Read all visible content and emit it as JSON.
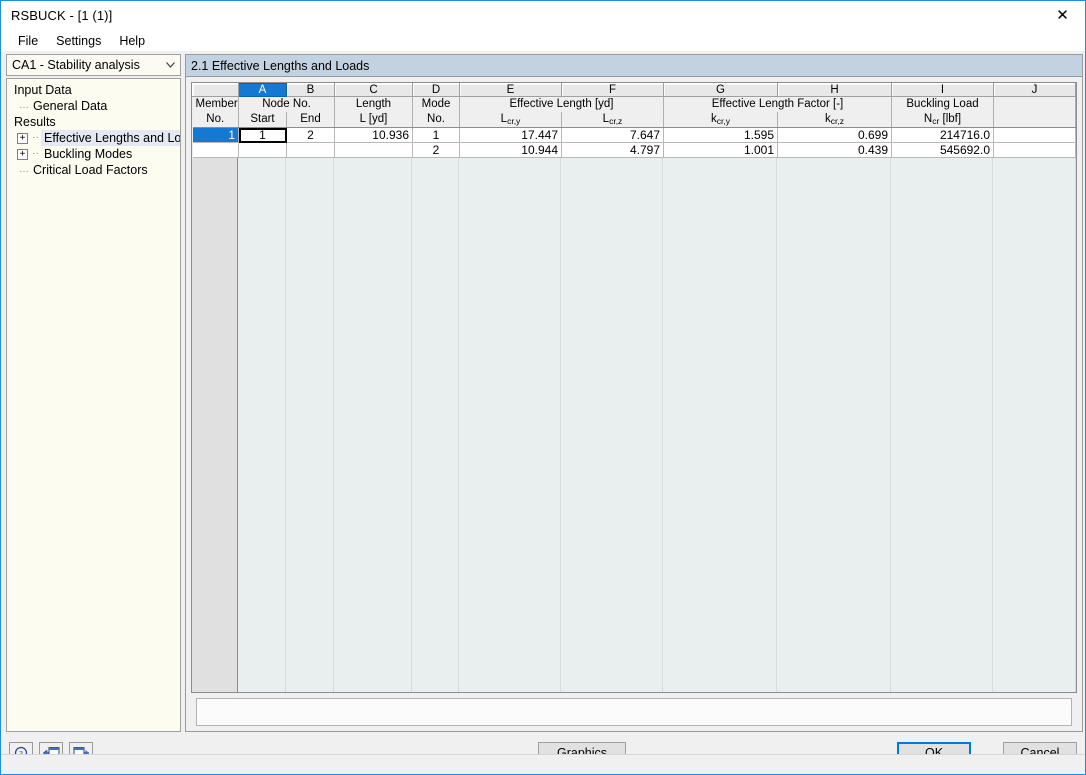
{
  "window": {
    "title": "RSBUCK - [1 (1)]",
    "close_icon": "close-icon"
  },
  "menubar": {
    "items": [
      {
        "label": "File"
      },
      {
        "label": "Settings"
      },
      {
        "label": "Help"
      }
    ]
  },
  "sidebar": {
    "combo": {
      "value": "CA1 - Stability analysis",
      "arrow_icon": "chevron-down-icon"
    },
    "tree": [
      {
        "label": "Input Data",
        "level": 0,
        "expander": "",
        "selected": false
      },
      {
        "label": "General Data",
        "level": 1,
        "expander": "",
        "selected": false
      },
      {
        "label": "Results",
        "level": 0,
        "expander": "",
        "selected": false
      },
      {
        "label": "Effective Lengths and Loads",
        "level": 1,
        "expander": "+",
        "selected": true
      },
      {
        "label": "Buckling Modes",
        "level": 1,
        "expander": "+",
        "selected": false
      },
      {
        "label": "Critical Load Factors",
        "level": 1,
        "expander": "",
        "selected": false
      }
    ]
  },
  "panel": {
    "title": "2.1 Effective Lengths and Loads"
  },
  "table": {
    "column_letters": [
      "",
      "A",
      "B",
      "C",
      "D",
      "E",
      "F",
      "G",
      "H",
      "I",
      "J"
    ],
    "selected_letter": "A",
    "group_headers": [
      {
        "text": "Member",
        "span": 1
      },
      {
        "text": "Node No.",
        "span": 2
      },
      {
        "text": "Length",
        "span": 1
      },
      {
        "text": "Mode",
        "span": 1
      },
      {
        "text": "Effective Length [yd]",
        "span": 2
      },
      {
        "text": "Effective Length Factor [-]",
        "span": 2
      },
      {
        "text": "Buckling Load",
        "span": 1
      },
      {
        "text": "",
        "span": 1
      }
    ],
    "sub_headers": [
      {
        "text": "No.",
        "sub": ""
      },
      {
        "text": "Start",
        "sub": ""
      },
      {
        "text": "End",
        "sub": ""
      },
      {
        "text": "L [yd]",
        "sub": ""
      },
      {
        "text": "No.",
        "sub": ""
      },
      {
        "text": "L",
        "sub": "cr,y"
      },
      {
        "text": "L",
        "sub": "cr,z"
      },
      {
        "text": "k",
        "sub": "cr,y"
      },
      {
        "text": "k",
        "sub": "cr,z"
      },
      {
        "text": "N",
        "sub": "cr",
        "suffix": " [lbf]"
      },
      {
        "text": "",
        "sub": ""
      }
    ],
    "rows": [
      {
        "row_header": "1",
        "selected": true,
        "cells": [
          {
            "value": "1",
            "align": "ctr",
            "focused": true
          },
          {
            "value": "2",
            "align": "ctr",
            "focused": false
          },
          {
            "value": "10.936",
            "align": "right",
            "focused": false
          },
          {
            "value": "1",
            "align": "ctr",
            "focused": false
          },
          {
            "value": "17.447",
            "align": "right",
            "focused": false
          },
          {
            "value": "7.647",
            "align": "right",
            "focused": false
          },
          {
            "value": "1.595",
            "align": "right",
            "focused": false
          },
          {
            "value": "0.699",
            "align": "right",
            "focused": false
          },
          {
            "value": "214716.0",
            "align": "right",
            "focused": false
          },
          {
            "value": "",
            "align": "right",
            "focused": false
          }
        ]
      },
      {
        "row_header": "",
        "selected": false,
        "cells": [
          {
            "value": "",
            "align": "ctr",
            "focused": false
          },
          {
            "value": "",
            "align": "ctr",
            "focused": false
          },
          {
            "value": "",
            "align": "right",
            "focused": false
          },
          {
            "value": "2",
            "align": "ctr",
            "focused": false
          },
          {
            "value": "10.944",
            "align": "right",
            "focused": false
          },
          {
            "value": "4.797",
            "align": "right",
            "focused": false
          },
          {
            "value": "1.001",
            "align": "right",
            "focused": false
          },
          {
            "value": "0.439",
            "align": "right",
            "focused": false
          },
          {
            "value": "545692.0",
            "align": "right",
            "focused": false
          },
          {
            "value": "",
            "align": "right",
            "focused": false
          }
        ]
      }
    ]
  },
  "footer": {
    "toolbar": [
      {
        "icon": "help-icon",
        "name": "help-button"
      },
      {
        "icon": "previous-panel-icon",
        "name": "previous-button"
      },
      {
        "icon": "next-panel-icon",
        "name": "next-button"
      }
    ],
    "graphics_label": "Graphics",
    "ok_label": "OK",
    "cancel_label": "Cancel"
  },
  "colors": {
    "accent": "#1578d2",
    "panel_header": "#c3d2e1",
    "window_border": "#1a8fe0",
    "grid_empty": "#e9eeef"
  }
}
